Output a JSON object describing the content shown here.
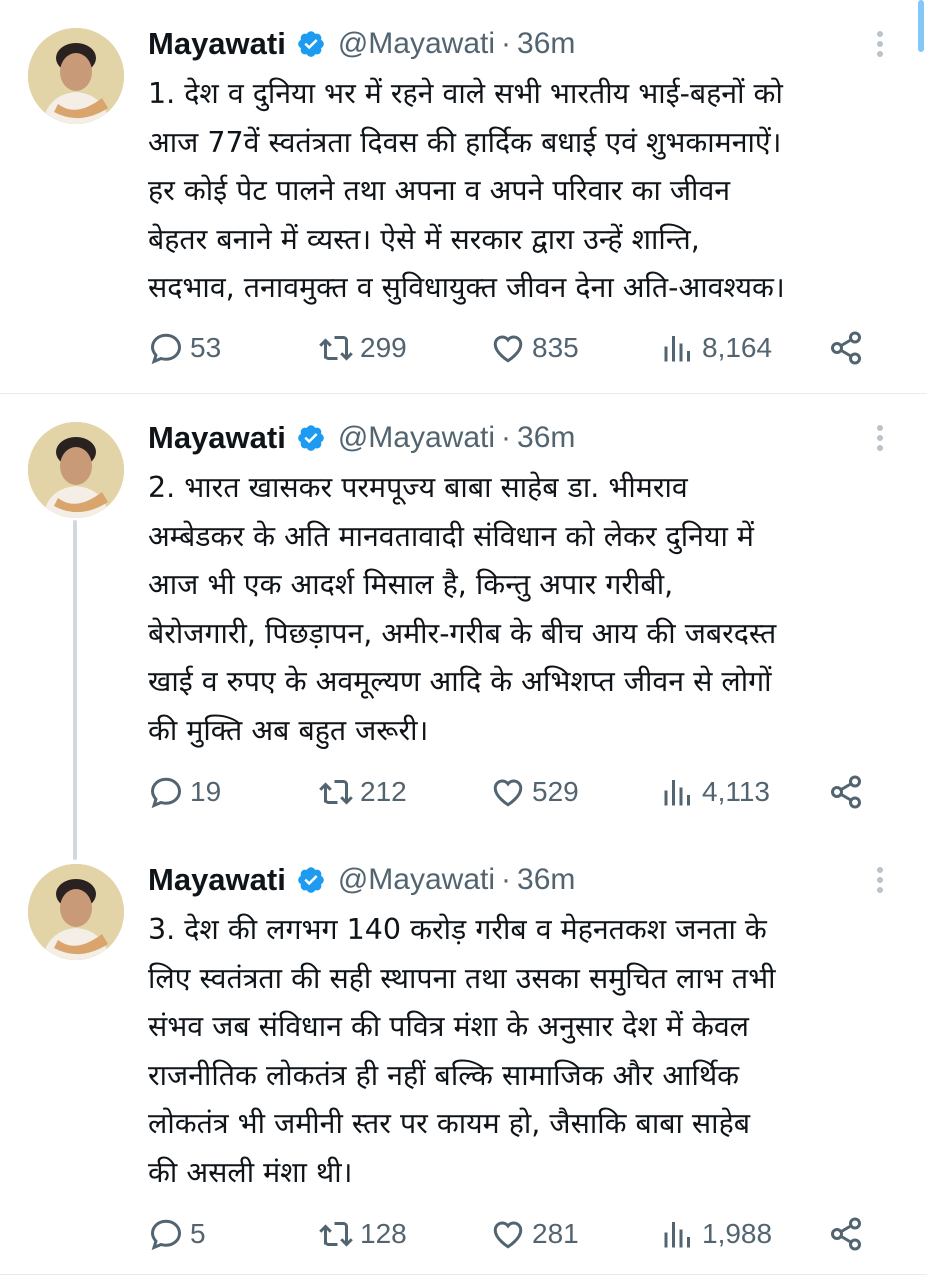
{
  "tweets": [
    {
      "name": "Mayawati",
      "handle": "@Mayawati",
      "dot": "·",
      "time": "36m",
      "text": "1. देश व दुनिया भर में रहने वाले सभी भारतीय भाई-बहनों को\nआज 77वें स्वतंत्रता दिवस की हार्दिक बधाई एवं शुभकामनाऐं।\nहर कोई पेट पालने तथा अपना व अपने परिवार का जीवन\nबेहतर बनाने में व्यस्त। ऐसे में सरकार द्वारा उन्हें शान्ति,\nसदभाव, तनावमुक्त व सुविधायुक्त जीवन देना अति-आवश्यक।",
      "replies": "53",
      "retweets": "299",
      "likes": "835",
      "views": "8,164"
    },
    {
      "name": "Mayawati",
      "handle": "@Mayawati",
      "dot": "·",
      "time": "36m",
      "text": "2. भारत खासकर परमपूज्य बाबा साहेब डा. भीमराव\nअम्बेडकर के अति मानवतावादी संविधान को लेकर दुनिया में\nआज भी एक आदर्श मिसाल है, किन्तु अपार गरीबी,\nबेरोजगारी, पिछड़ापन, अमीर-गरीब के बीच आय की जबरदस्त\nखाई व रुपए के अवमूल्यण आदि के अभिशप्त जीवन से लोगों\nकी मुक्ति अब बहुत जरूरी।",
      "replies": "19",
      "retweets": "212",
      "likes": "529",
      "views": "4,113"
    },
    {
      "name": "Mayawati",
      "handle": "@Mayawati",
      "dot": "·",
      "time": "36m",
      "text": "3. देश की लगभग 140 करोड़ गरीब व मेहनतकश जनता के\nलिए स्वतंत्रता की सही स्थापना तथा उसका समुचित लाभ तभी\nसंभव जब संविधान की पवित्र मंशा के अनुसार देश में केवल\nराजनीतिक लोकतंत्र ही नहीं बल्कि सामाजिक और आर्थिक\nलोकतंत्र भी जमीनी स्तर पर कायम हो, जैसाकि बाबा साहेब\nकी असली मंशा थी।",
      "replies": "5",
      "retweets": "128",
      "likes": "281",
      "views": "1,988"
    }
  ],
  "colors": {
    "verified": "#1d9bf0",
    "secondary_text": "#536471",
    "primary_text": "#0f1419",
    "divider": "#e6ecf0"
  },
  "icons": [
    "verified-badge-icon",
    "more-options-icon",
    "reply-icon",
    "retweet-icon",
    "like-icon",
    "views-icon",
    "share-icon"
  ]
}
